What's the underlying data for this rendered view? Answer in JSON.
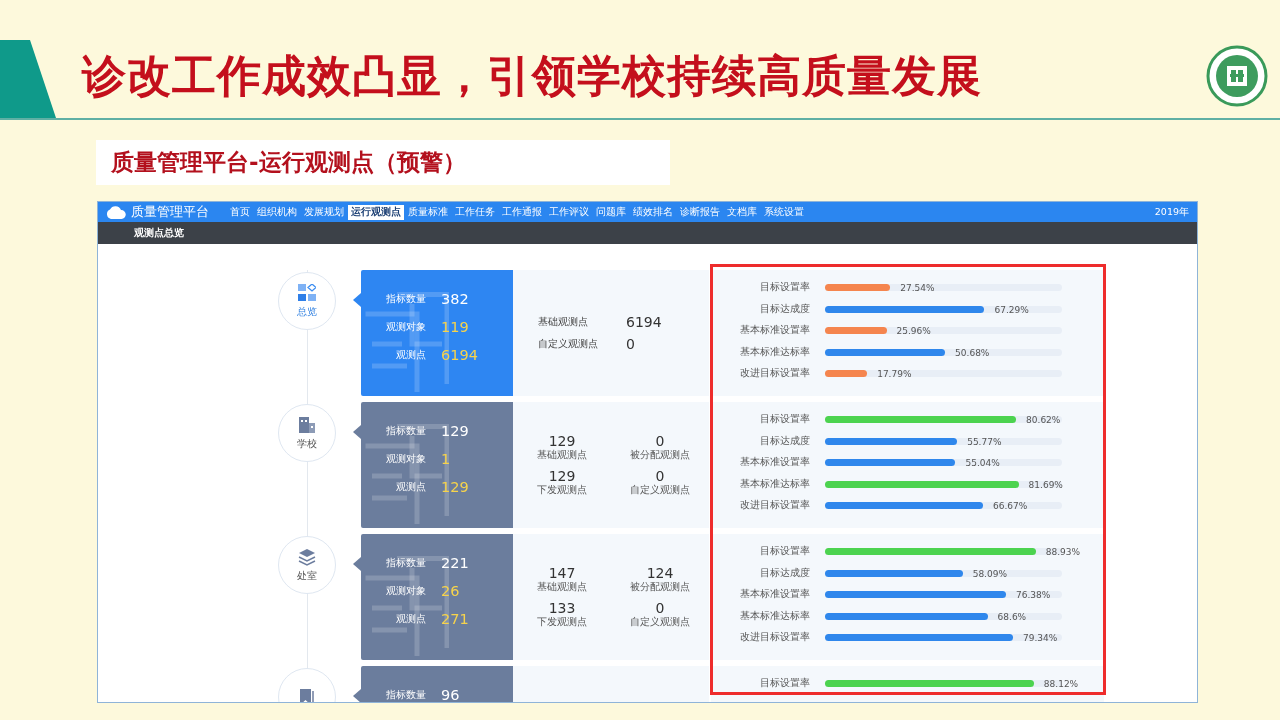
{
  "slide": {
    "title": "诊改工作成效凸显，引领学校持续高质量发展",
    "subtitle": "质量管理平台-运行观测点（预警）"
  },
  "app": {
    "brand": "质量管理平台",
    "year": "2019年",
    "breadcrumb": "观测点总览",
    "nav": [
      {
        "label": "首页",
        "selected": false
      },
      {
        "label": "组织机构",
        "selected": false
      },
      {
        "label": "发展规划",
        "selected": false
      },
      {
        "label": "运行观测点",
        "selected": true
      },
      {
        "label": "质量标准",
        "selected": false
      },
      {
        "label": "工作任务",
        "selected": false
      },
      {
        "label": "工作通报",
        "selected": false
      },
      {
        "label": "工作评议",
        "selected": false
      },
      {
        "label": "问题库",
        "selected": false
      },
      {
        "label": "绩效排名",
        "selected": false
      },
      {
        "label": "诊断报告",
        "selected": false
      },
      {
        "label": "文档库",
        "selected": false
      },
      {
        "label": "系统设置",
        "selected": false
      }
    ]
  },
  "sections": [
    {
      "node": {
        "label": "总览"
      },
      "selected": true,
      "stats": [
        {
          "label": "指标数量",
          "value": "382",
          "emphasis": false
        },
        {
          "label": "观测对象",
          "value": "119",
          "emphasis": true
        },
        {
          "label": "观测点",
          "value": "6194",
          "emphasis": true
        }
      ],
      "counts": {
        "kind": "pair",
        "items": [
          {
            "label": "基础观测点",
            "value": "6194"
          },
          {
            "label": "自定义观测点",
            "value": "0"
          }
        ]
      },
      "metrics": [
        {
          "label": "目标设置率",
          "level": 0.2754,
          "reading": "27.54%",
          "color": "#f5854e"
        },
        {
          "label": "目标达成度",
          "level": 0.6729,
          "reading": "67.29%",
          "color": "#2f87ec"
        },
        {
          "label": "基本标准设置率",
          "level": 0.2596,
          "reading": "25.96%",
          "color": "#f5854e"
        },
        {
          "label": "基本标准达标率",
          "level": 0.5068,
          "reading": "50.68%",
          "color": "#2f87ec"
        },
        {
          "label": "改进目标设置率",
          "level": 0.1779,
          "reading": "17.79%",
          "color": "#f5854e"
        }
      ]
    },
    {
      "node": {
        "label": "学校"
      },
      "selected": false,
      "stats": [
        {
          "label": "指标数量",
          "value": "129",
          "emphasis": false
        },
        {
          "label": "观测对象",
          "value": "1",
          "emphasis": true
        },
        {
          "label": "观测点",
          "value": "129",
          "emphasis": true
        }
      ],
      "counts": {
        "kind": "grid",
        "items": [
          {
            "label": "基础观测点",
            "value": "129"
          },
          {
            "label": "被分配观测点",
            "value": "0"
          },
          {
            "label": "下发观测点",
            "value": "129"
          },
          {
            "label": "自定义观测点",
            "value": "0"
          }
        ]
      },
      "metrics": [
        {
          "label": "目标设置率",
          "level": 0.8062,
          "reading": "80.62%",
          "color": "#4cd34f"
        },
        {
          "label": "目标达成度",
          "level": 0.5577,
          "reading": "55.77%",
          "color": "#2f87ec"
        },
        {
          "label": "基本标准设置率",
          "level": 0.5504,
          "reading": "55.04%",
          "color": "#2f87ec"
        },
        {
          "label": "基本标准达标率",
          "level": 0.8169,
          "reading": "81.69%",
          "color": "#4cd34f"
        },
        {
          "label": "改进目标设置率",
          "level": 0.6667,
          "reading": "66.67%",
          "color": "#2f87ec"
        }
      ]
    },
    {
      "node": {
        "label": "处室"
      },
      "selected": false,
      "stats": [
        {
          "label": "指标数量",
          "value": "221",
          "emphasis": false
        },
        {
          "label": "观测对象",
          "value": "26",
          "emphasis": true
        },
        {
          "label": "观测点",
          "value": "271",
          "emphasis": true
        }
      ],
      "counts": {
        "kind": "grid",
        "items": [
          {
            "label": "基础观测点",
            "value": "147"
          },
          {
            "label": "被分配观测点",
            "value": "124"
          },
          {
            "label": "下发观测点",
            "value": "133"
          },
          {
            "label": "自定义观测点",
            "value": "0"
          }
        ]
      },
      "metrics": [
        {
          "label": "目标设置率",
          "level": 0.8893,
          "reading": "88.93%",
          "color": "#4cd34f"
        },
        {
          "label": "目标达成度",
          "level": 0.5809,
          "reading": "58.09%",
          "color": "#2f87ec"
        },
        {
          "label": "基本标准设置率",
          "level": 0.7638,
          "reading": "76.38%",
          "color": "#2f87ec"
        },
        {
          "label": "基本标准达标率",
          "level": 0.686,
          "reading": "68.6%",
          "color": "#2f87ec"
        },
        {
          "label": "改进目标设置率",
          "level": 0.7934,
          "reading": "79.34%",
          "color": "#2f87ec"
        }
      ]
    },
    {
      "selected": false,
      "stats": [
        {
          "label": "指标数量",
          "value": "96",
          "emphasis": false
        }
      ],
      "metrics": [
        {
          "label": "目标设置率",
          "level": 0.8812,
          "reading": "88.12%",
          "color": "#4cd34f"
        }
      ]
    }
  ]
}
